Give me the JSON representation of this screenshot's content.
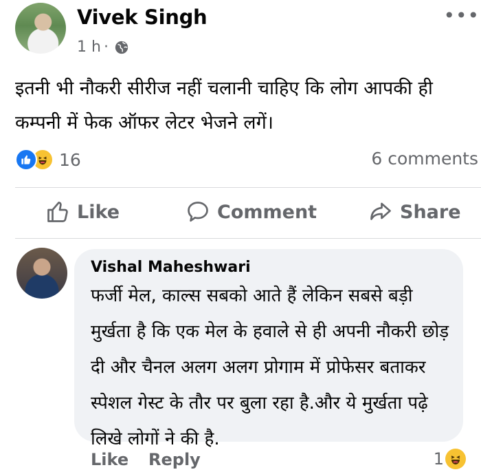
{
  "post": {
    "author": "Vivek Singh",
    "time": "1 h",
    "dot": "·",
    "more": "•••",
    "text": "इतनी भी नौकरी सीरीज नहीं चलानी चाहिए कि लोग आपकी ही कम्पनी में फेक ऑफर लेटर भेजने लगें।",
    "reaction_count": "16",
    "comment_count": "6 comments",
    "reaction_icons": [
      "like-icon",
      "haha-icon"
    ]
  },
  "actions": {
    "like": "Like",
    "comment": "Comment",
    "share": "Share"
  },
  "comment": {
    "author": "Vishal Maheshwari",
    "text": "फर्जी मेल, काल्स सबको आते हैं लेकिन सबसे बड़ी मुर्खता है कि एक मेल के हवाले से ही अपनी नौकरी छोड़ दी और चैनल अलग अलग प्रोगाम में प्रोफेसर बताकर स्पेशल गेस्ट के तौर पर बुला रहा है.और ये मुर्खता पढ़े लिखे लोगों ने की है.",
    "like": "Like",
    "reply": "Reply",
    "reaction_count": "1"
  },
  "colors": {
    "accent": "#1877f2",
    "muted_text": "#65676b",
    "bubble": "#f0f2f5",
    "haha": "#f7c232"
  }
}
